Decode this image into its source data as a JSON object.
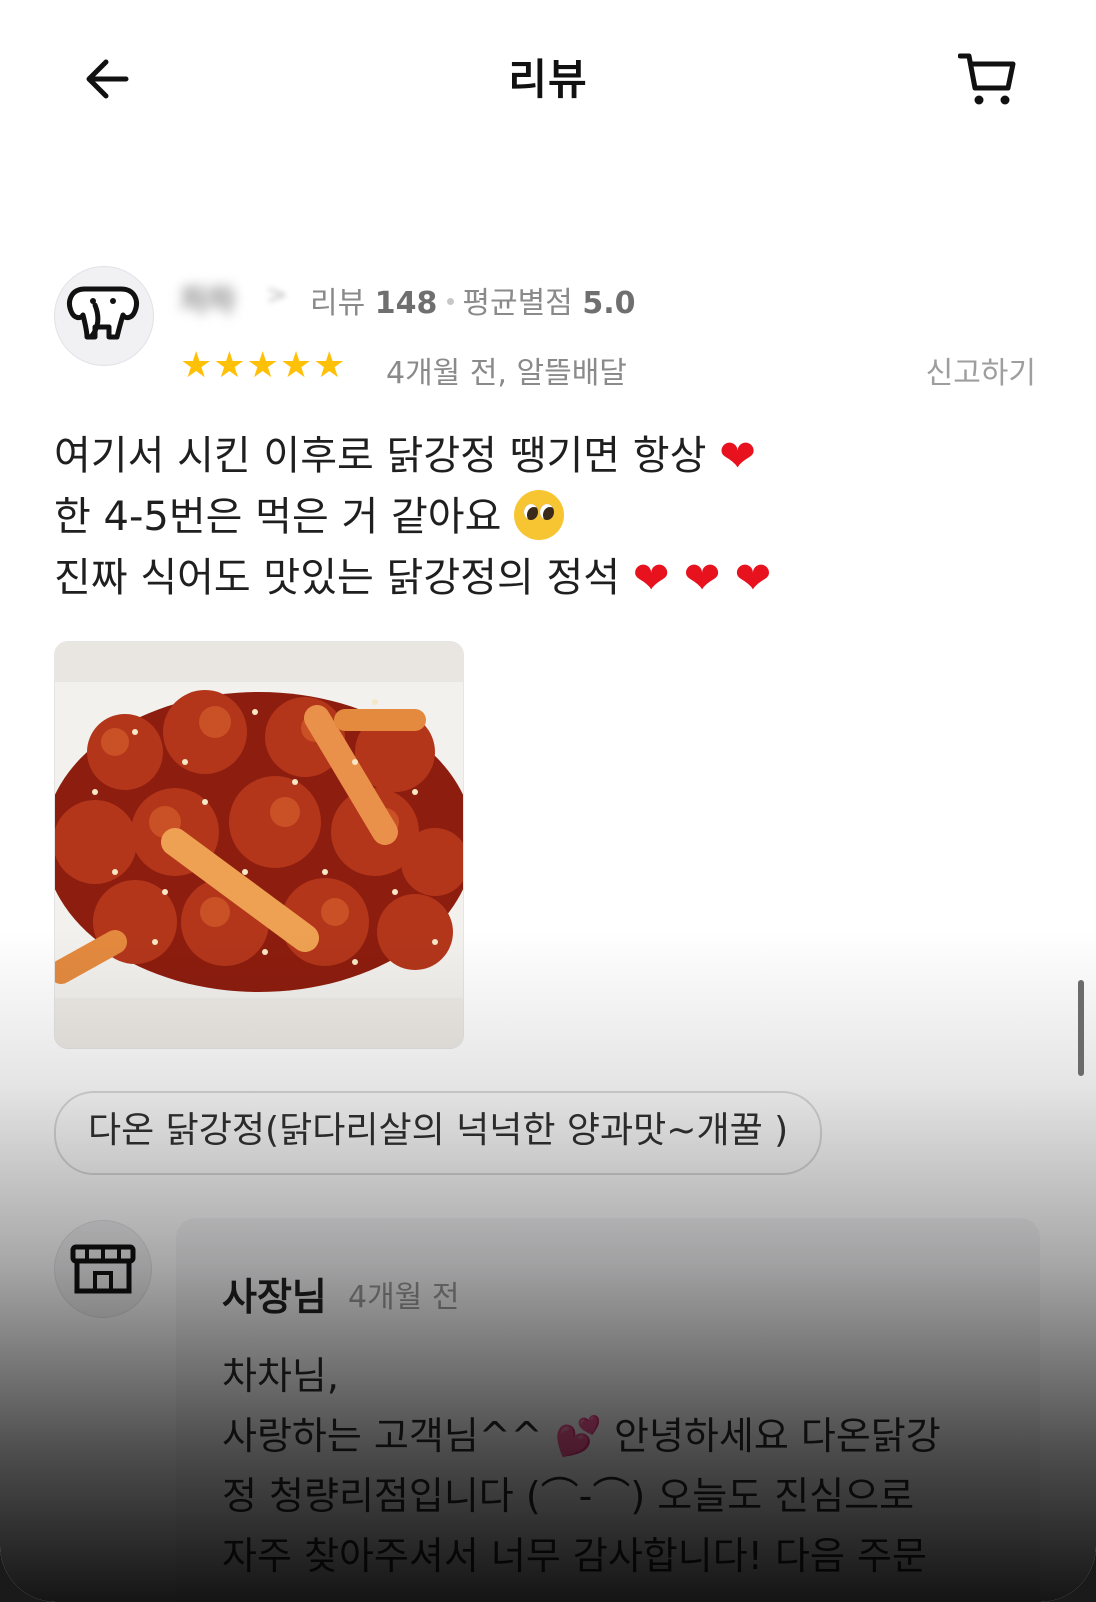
{
  "header": {
    "title": "리뷰",
    "back_icon": "arrow-left-icon",
    "cart_icon": "cart-icon"
  },
  "review": {
    "nickname": "차차",
    "nickname_chevron": ">",
    "review_count_label": "리뷰",
    "review_count": "148",
    "avg_rating_label": "평균별점",
    "avg_rating": "5.0",
    "stars": "★★★★★",
    "rating": 5,
    "time_and_type": "4개월 전, 알뜰배달",
    "report_label": "신고하기",
    "lines": [
      "여기서 시킨 이후로 닭강정 땡기면 항상",
      "한 4-5번은 먹은 거 같아요",
      "진짜 식어도 맛있는 닭강정의 정석"
    ],
    "heart": "❤",
    "hearts_line3": "❤ ❤ ❤",
    "menu_item": "다온 닭강정(닭다리살의 넉넉한 양과맛~개꿀 )"
  },
  "owner_reply": {
    "name": "사장님",
    "time": "4개월 전",
    "lines": [
      "차차님,",
      "사랑하는 고객님^^",
      "안녕하세요 다온닭강",
      "정 청량리점입니다 (",
      "⌒-⌒",
      ") 오늘도 진심으로",
      "자주 찾아주셔서 너무 감사합니다! 다음 주문"
    ],
    "pink_heart": "💕"
  },
  "colors": {
    "star": "#FFC107",
    "heart": "#E8121F",
    "text": "#1F1F1F",
    "muted": "#8A8A8A"
  }
}
